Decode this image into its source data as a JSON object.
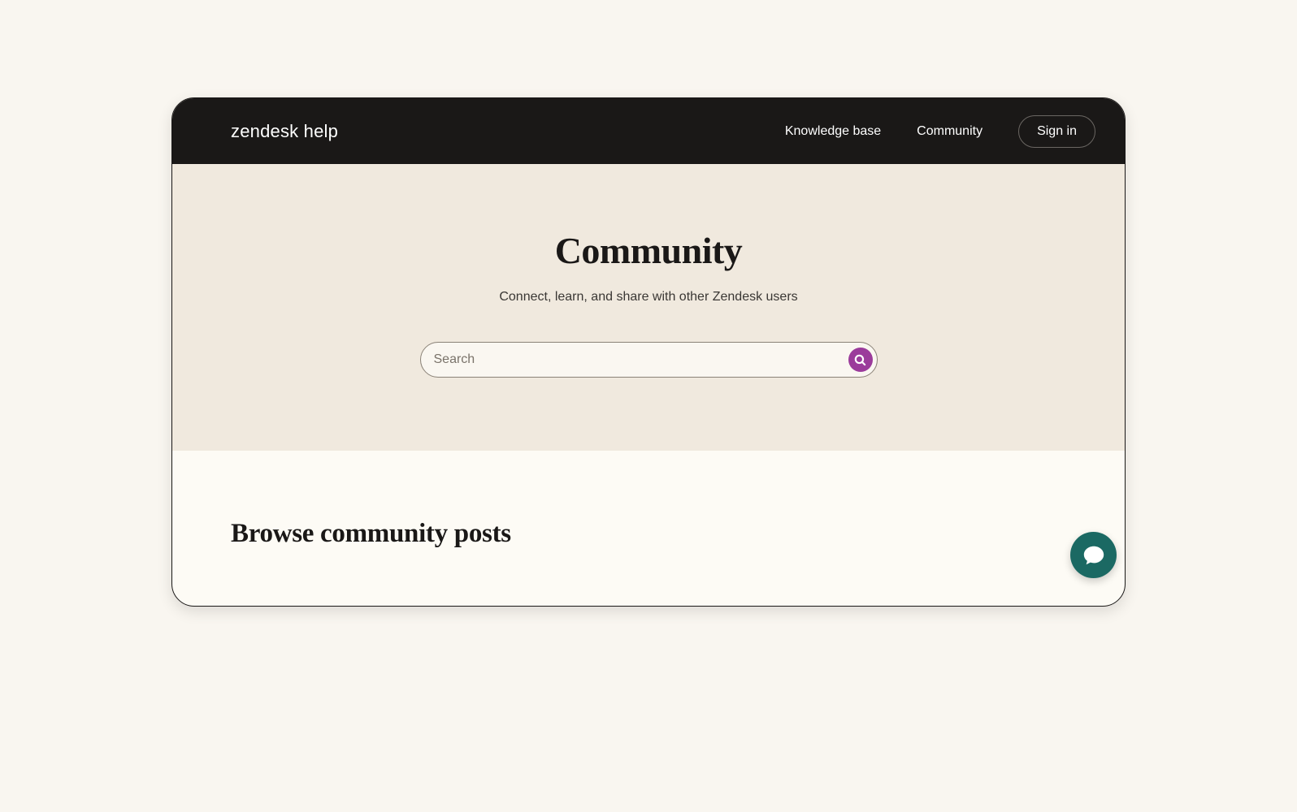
{
  "header": {
    "logo": "zendesk help",
    "nav": {
      "knowledge_base": "Knowledge base",
      "community": "Community",
      "sign_in": "Sign in"
    }
  },
  "hero": {
    "title": "Community",
    "subtitle": "Connect, learn, and share with other Zendesk users",
    "search_placeholder": "Search"
  },
  "browse": {
    "title": "Browse community posts"
  }
}
